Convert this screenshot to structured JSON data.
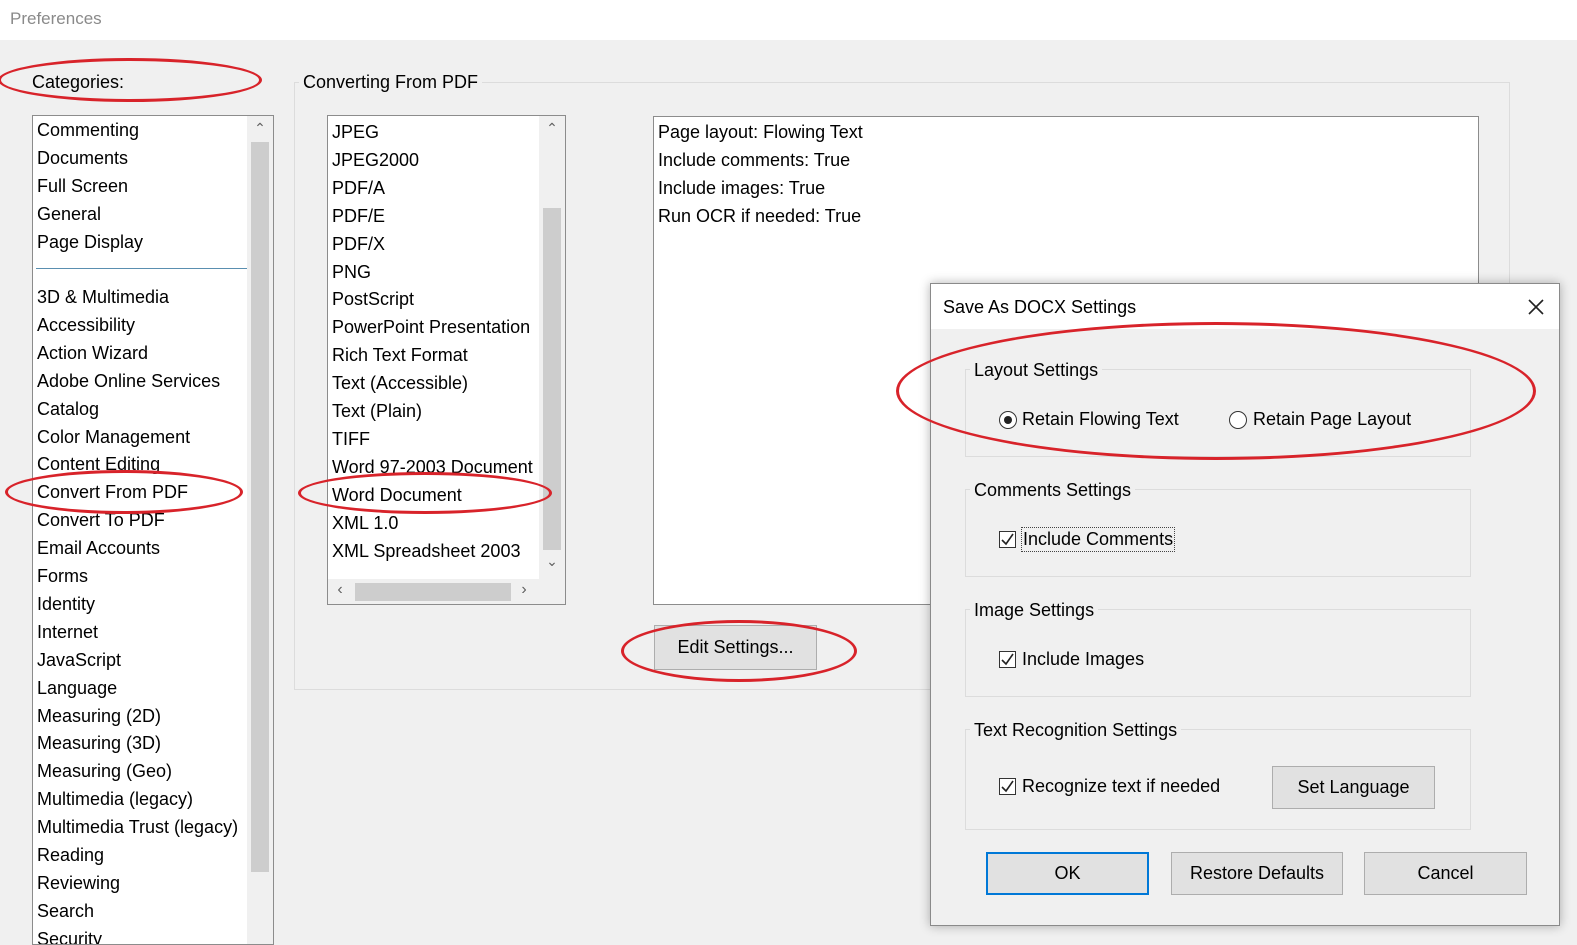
{
  "window": {
    "title": "Preferences"
  },
  "categories": {
    "label": "Categories:",
    "top_items": [
      "Commenting",
      "Documents",
      "Full Screen",
      "General",
      "Page Display"
    ],
    "items": [
      "3D & Multimedia",
      "Accessibility",
      "Action Wizard",
      "Adobe Online Services",
      "Catalog",
      "Color Management",
      "Content Editing",
      "Convert From PDF",
      "Convert To PDF",
      "Email Accounts",
      "Forms",
      "Identity",
      "Internet",
      "JavaScript",
      "Language",
      "Measuring (2D)",
      "Measuring (3D)",
      "Measuring (Geo)",
      "Multimedia (legacy)",
      "Multimedia Trust (legacy)",
      "Reading",
      "Reviewing",
      "Search",
      "Security"
    ],
    "selected": "Convert From PDF"
  },
  "converting": {
    "group_label": "Converting From PDF",
    "formats": [
      "JPEG",
      "JPEG2000",
      "PDF/A",
      "PDF/E",
      "PDF/X",
      "PNG",
      "PostScript",
      "PowerPoint Presentation",
      "Rich Text Format",
      "Text (Accessible)",
      "Text (Plain)",
      "TIFF",
      "Word 97-2003 Document",
      "Word Document",
      "XML 1.0",
      "XML Spreadsheet 2003"
    ],
    "selected_format": "Word Document",
    "settings_summary": [
      "Page layout: Flowing Text",
      "Include comments: True",
      "Include images: True",
      "Run OCR if needed: True"
    ],
    "edit_button": "Edit Settings..."
  },
  "dialog": {
    "title": "Save As DOCX Settings",
    "layout": {
      "title": "Layout Settings",
      "option1": "Retain Flowing Text",
      "option2": "Retain Page Layout",
      "selected": "Retain Flowing Text"
    },
    "comments": {
      "title": "Comments Settings",
      "checkbox": "Include Comments",
      "checked": true
    },
    "images": {
      "title": "Image Settings",
      "checkbox": "Include Images",
      "checked": true
    },
    "text_recognition": {
      "title": "Text Recognition Settings",
      "checkbox": "Recognize text if needed",
      "checked": true,
      "button": "Set Language"
    },
    "buttons": {
      "ok": "OK",
      "restore": "Restore Defaults",
      "cancel": "Cancel"
    }
  },
  "colors": {
    "annotation_red": "#d8232a",
    "focus_blue": "#0078d7"
  }
}
